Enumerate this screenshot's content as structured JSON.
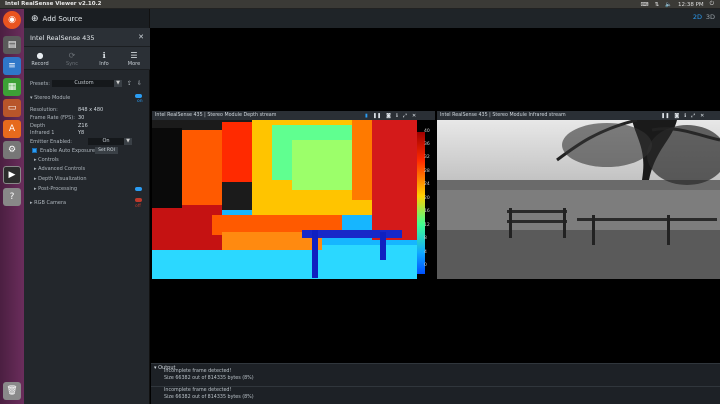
{
  "window_title": "Intel RealSense Viewer v2.10.2",
  "tray": {
    "time": "12:38 PM"
  },
  "header": {
    "add_source": "Add Source",
    "view_2d": "2D",
    "view_3d": "3D"
  },
  "device": {
    "name": "Intel RealSense 435",
    "tools": [
      {
        "label": "Record",
        "icon": "record-icon"
      },
      {
        "label": "Sync",
        "icon": "sync-icon"
      },
      {
        "label": "Info",
        "icon": "info-icon"
      },
      {
        "label": "More",
        "icon": "menu-icon"
      }
    ],
    "presets_label": "Presets:",
    "preset_value": "Custom",
    "stereo_module": "Stereo Module",
    "on_label": "on",
    "off_label": "off",
    "settings": [
      {
        "label": "Resolution:",
        "value": "848 x 480"
      },
      {
        "label": "Frame Rate (FPS):",
        "value": "30"
      },
      {
        "label": "Depth",
        "value": "Z16"
      },
      {
        "label": "Infrared 1",
        "value": "Y8"
      }
    ],
    "emitter_label": "Emitter Enabled:",
    "emitter_value": "On",
    "auto_exposure": "Enable Auto Exposure",
    "set_roi": "Set ROI",
    "controls": "Controls",
    "advanced_controls": "Advanced Controls",
    "depth_visualization": "Depth Visualization",
    "post_processing": "Post-Processing",
    "rgb_camera": "RGB Camera"
  },
  "streams": {
    "depth_title": "Intel RealSense 435 | Stereo Module Depth stream",
    "infrared_title": "Intel RealSense 435 | Stereo Module Infrared stream",
    "colorbar_ticks": [
      "40",
      "36",
      "32",
      "28",
      "24",
      "20",
      "16",
      "12",
      "8",
      "4",
      "0"
    ]
  },
  "output": {
    "label": "Output",
    "lines": [
      "Incomplete frame detected!",
      "Size 66382 out of 814335 bytes (8%)",
      "Incomplete frame detected!",
      "Size 66382 out of 814335 bytes (8%)"
    ]
  }
}
